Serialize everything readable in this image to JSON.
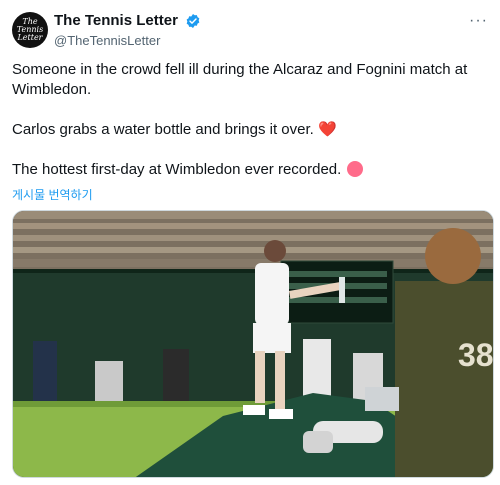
{
  "header": {
    "avatar_text": "The\nTennis\nLetter",
    "display_name": "The Tennis Letter",
    "handle": "@TheTennisLetter",
    "more_label": "···"
  },
  "tweet": {
    "line1": "Someone in the crowd fell ill during the Alcaraz and Fognini match at Wimbledon.",
    "line2": "Carlos grabs a water bottle and brings it over.",
    "line2_emoji": "❤️",
    "line3": "The hottest first-day at Wimbledon ever recorded.",
    "translate_link": "게시물 번역하기"
  },
  "media": {
    "player_shirt_number": "38"
  },
  "colors": {
    "accent": "#1d9bf0",
    "text": "#0f1419",
    "secondary": "#536471",
    "heart": "#e0245e",
    "verified": "#1d9bf0"
  }
}
